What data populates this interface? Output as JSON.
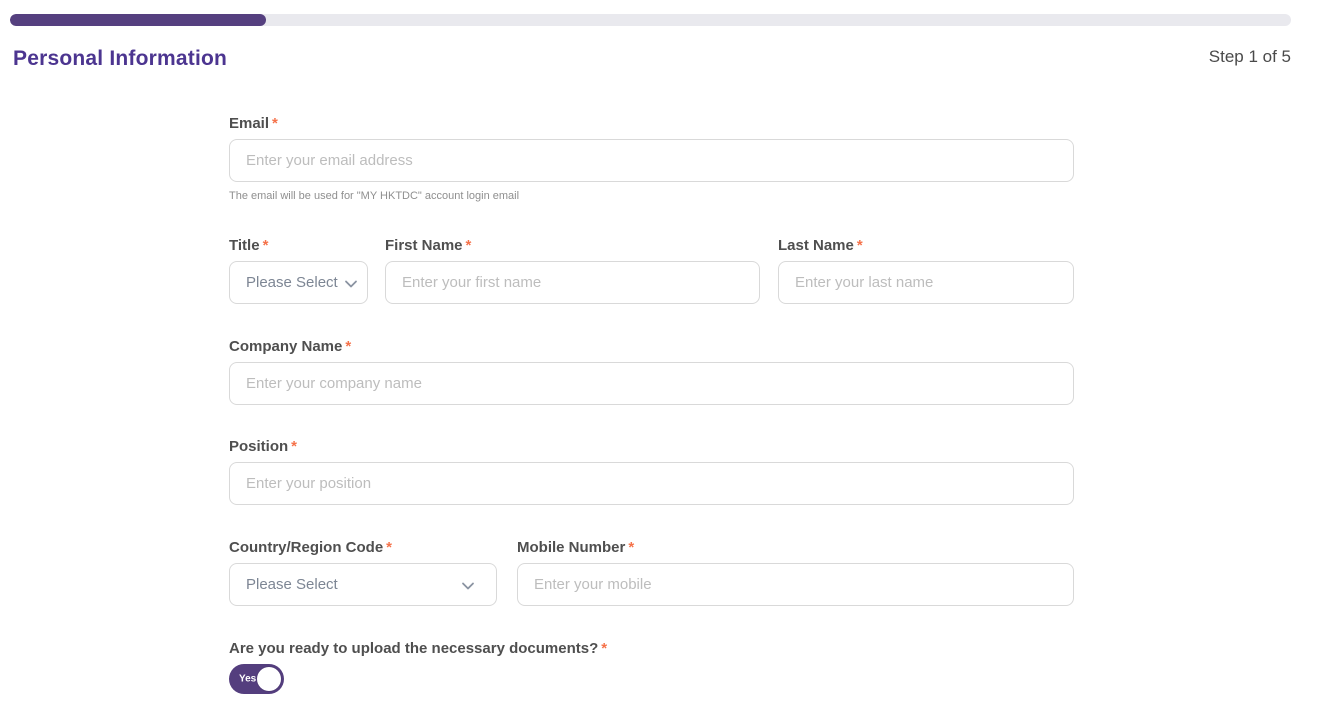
{
  "progress": {
    "percent": 20,
    "fill_color": "#55407f",
    "track_color": "#e9e9ee"
  },
  "header": {
    "title": "Personal Information",
    "step_label": "Step 1 of 5"
  },
  "colors": {
    "accent_purple": "#4c3590",
    "asterisk_orange": "#f5724a",
    "label_gray": "#4f4f4f",
    "placeholder_gray": "#bdbdbd",
    "border_gray": "#d9d9d9"
  },
  "icons": {
    "select_chevron": "chevron-down"
  },
  "form": {
    "email": {
      "label": "Email",
      "required": "*",
      "placeholder": "Enter your email address",
      "helper": "The email will be used for \"MY HKTDC\" account login email"
    },
    "title_select": {
      "label": "Title",
      "required": "*",
      "value": "Please Select"
    },
    "first_name": {
      "label": "First Name",
      "required": "*",
      "placeholder": "Enter your first name"
    },
    "last_name": {
      "label": "Last Name",
      "required": "*",
      "placeholder": "Enter your last name"
    },
    "company_name": {
      "label": "Company Name",
      "required": "*",
      "placeholder": "Enter your company name"
    },
    "position": {
      "label": "Position",
      "required": "*",
      "placeholder": "Enter your position"
    },
    "country_code": {
      "label": "Country/Region Code",
      "required": "*",
      "value": "Please Select"
    },
    "mobile": {
      "label": "Mobile Number",
      "required": "*",
      "placeholder": "Enter your mobile"
    },
    "upload_question": {
      "label": "Are you ready to upload the necessary documents?",
      "required": "*",
      "toggle_state": "Yes"
    }
  }
}
